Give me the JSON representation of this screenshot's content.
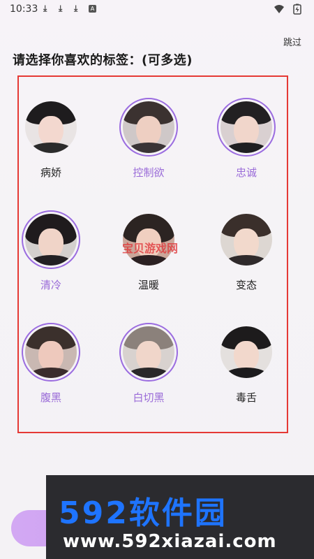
{
  "status": {
    "time": "10:33"
  },
  "header": {
    "skip_label": "跳过",
    "title": "请选择你喜欢的标签：(可多选)"
  },
  "tags": [
    {
      "label": "病娇",
      "selected": false
    },
    {
      "label": "控制欲",
      "selected": true
    },
    {
      "label": "忠诚",
      "selected": true
    },
    {
      "label": "清冷",
      "selected": true
    },
    {
      "label": "温暖",
      "selected": false
    },
    {
      "label": "变态",
      "selected": false
    },
    {
      "label": "腹黑",
      "selected": true
    },
    {
      "label": "白切黑",
      "selected": true
    },
    {
      "label": "毒舌",
      "selected": false
    }
  ],
  "watermark": {
    "center_text": "宝贝游戏网",
    "brand": "592软件园",
    "url": "www.592xiazai.com"
  },
  "colors": {
    "accent": "#9a6bd8",
    "highlight_border": "#e53935",
    "button": "#cfa6f2"
  }
}
